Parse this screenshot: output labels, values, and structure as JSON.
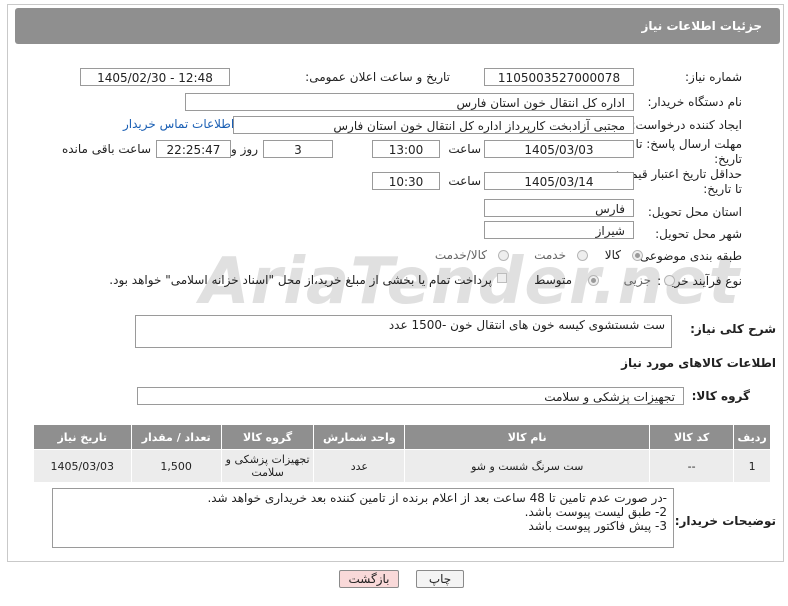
{
  "header": {
    "title": "جزئیات اطلاعات نیاز"
  },
  "need_number": {
    "label": "شماره نیاز:",
    "value": "1105003527000078"
  },
  "announce": {
    "label": "تاریخ و ساعت اعلان عمومی:",
    "value": "1405/02/30 - 12:48"
  },
  "buyer": {
    "label": "نام دستگاه خریدار:",
    "value": "اداره کل انتقال خون استان فارس"
  },
  "creator": {
    "label": "ایجاد کننده درخواست:",
    "value": "مجتبی آزادبخت کارپرداز اداره کل انتقال خون استان فارس",
    "contact_link": "اطلاعات تماس خریدار"
  },
  "reply_deadline": {
    "label1": "مهلت ارسال پاسخ: تا",
    "label2": "تاریخ:",
    "date": "1405/03/03",
    "time_label": "ساعت",
    "time": "13:00",
    "days": "3",
    "days_label": "روز و",
    "remaining": "22:25:47",
    "remaining_label": "ساعت باقی مانده"
  },
  "price_deadline": {
    "label1": "حداقل تاریخ اعتبار قیمت:",
    "label2": "تا تاریخ:",
    "date": "1405/03/14",
    "time_label": "ساعت",
    "time": "10:30"
  },
  "province": {
    "label": "استان محل تحویل:",
    "value": "فارس"
  },
  "city": {
    "label": "شهر محل تحویل:",
    "value": "شیراز"
  },
  "category": {
    "label": "طبقه بندی موضوعی:",
    "options": [
      "کالا",
      "خدمت",
      "کالا/خدمت"
    ],
    "selected": "کالا"
  },
  "purchase_type": {
    "label": "نوع فرآیند خرید :",
    "options": [
      "جزیی",
      "متوسط"
    ],
    "selected": "متوسط",
    "note": "پرداخت تمام یا بخشی از مبلغ خرید،از محل \"اسناد خزانه اسلامی\" خواهد بود."
  },
  "description": {
    "label": "شرح کلی نیاز:",
    "value": "ست شستشوی کیسه خون های انتقال خون -1500 عدد"
  },
  "goods_section": {
    "title": "اطلاعات کالاهای مورد نیاز"
  },
  "goods_group": {
    "label": "گروه کالا:",
    "value": "تجهیزات پزشکی و سلامت"
  },
  "table": {
    "headers": [
      "ردیف",
      "کد کالا",
      "نام کالا",
      "واحد شمارش",
      "گروه کالا",
      "تعداد / مقدار",
      "تاریخ نیاز"
    ],
    "rows": [
      [
        "1",
        "--",
        "ست سرنگ شست و شو",
        "عدد",
        "تجهیزات پزشکی و سلامت",
        "1,500",
        "1405/03/03"
      ]
    ]
  },
  "buyer_notes": {
    "label": "توضیحات خریدار:",
    "lines": [
      "-در صورت عدم تامین تا 48 ساعت بعد از اعلام برنده  از تامین کننده بعد خریداری خواهد شد.",
      "2- طبق لیست پیوست باشد.",
      "3- پیش فاکتور پیوست باشد"
    ]
  },
  "buttons": {
    "print": "چاپ",
    "back": "بازگشت"
  },
  "watermark": {
    "brand": "AriaTender.net"
  },
  "colors": {
    "header_bg": "#8f8f8f",
    "link": "#1a5fb4",
    "back_button": "#f9d9d9"
  }
}
